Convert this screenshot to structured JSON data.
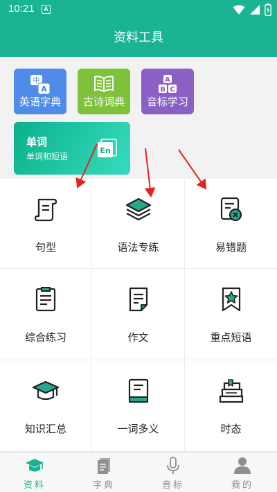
{
  "status": {
    "time": "10:21",
    "notif_glyph": "A"
  },
  "appbar": {
    "title": "资料工具"
  },
  "cards": {
    "english_dict": {
      "label": "英语字典",
      "icon": "translate-icon",
      "badge_cn": "中",
      "badge_en": "A"
    },
    "poem_dict": {
      "label": "古诗词典",
      "icon": "open-book-icon"
    },
    "phonetics": {
      "label": "音标学习",
      "icon": "abc-blocks-icon",
      "letters": [
        "A",
        "B",
        "C"
      ]
    },
    "words": {
      "title": "单词",
      "subtitle": "单词和短语",
      "icon": "en-book-icon",
      "icon_text": "En"
    }
  },
  "grid": [
    {
      "label": "句型",
      "icon": "scroll-icon"
    },
    {
      "label": "语法专练",
      "icon": "layers-icon"
    },
    {
      "label": "易错题",
      "icon": "error-doc-icon"
    },
    {
      "label": "综合练习",
      "icon": "clipboard-icon"
    },
    {
      "label": "作文",
      "icon": "document-icon"
    },
    {
      "label": "重点短语",
      "icon": "star-bookmark-icon"
    },
    {
      "label": "知识汇总",
      "icon": "graduation-cap-icon"
    },
    {
      "label": "一词多义",
      "icon": "book-icon"
    },
    {
      "label": "时态",
      "icon": "book-stack-icon"
    }
  ],
  "tabs": [
    {
      "label": "资料",
      "icon": "graduation-cap-icon",
      "active": true
    },
    {
      "label": "字典",
      "icon": "dictionary-icon",
      "active": false
    },
    {
      "label": "音标",
      "icon": "microphone-icon",
      "active": false
    },
    {
      "label": "我的",
      "icon": "user-icon",
      "active": false
    }
  ],
  "colors": {
    "primary": "#1ab394",
    "card_blue": "#4f8be9",
    "card_green": "#7ec23a",
    "card_purple": "#8a60c4",
    "annotation_red": "#e32222",
    "icon_teal": "#27a88d",
    "tab_inactive": "#8f8f8f"
  }
}
